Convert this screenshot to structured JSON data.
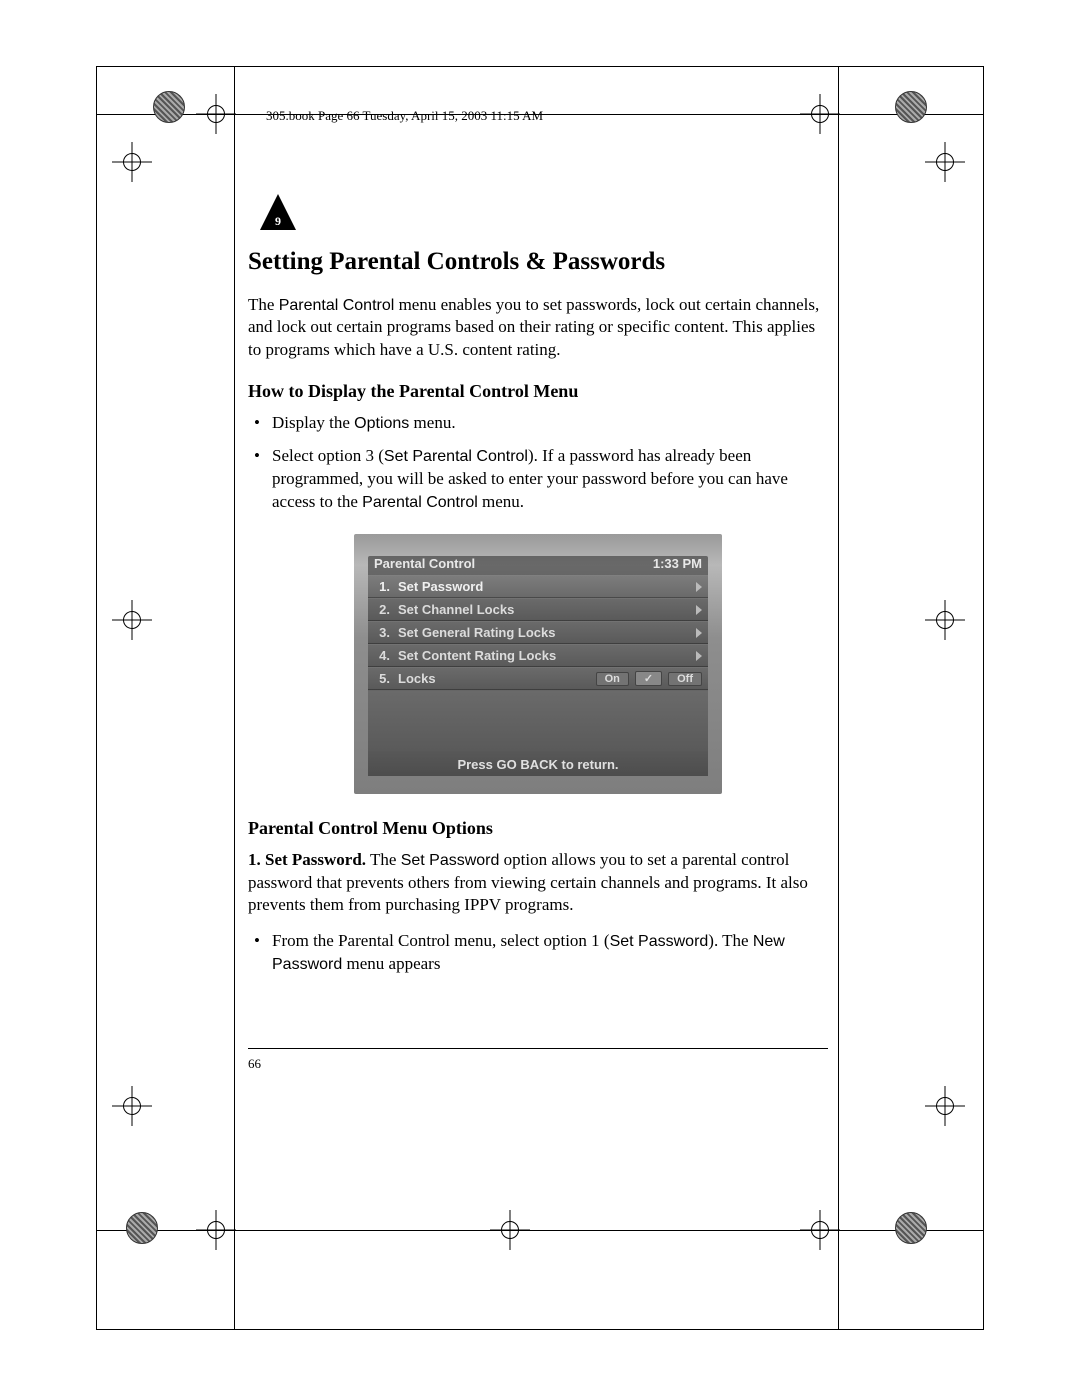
{
  "meta": {
    "header_line": "305.book  Page 66  Tuesday, April 15, 2003  11:15 AM",
    "page_number": "66",
    "chapter_tab": "9"
  },
  "headings": {
    "h1": "Setting Parental Controls & Passwords",
    "h2a": "How to Display the Parental Control Menu",
    "h2b": "Parental Control Menu Options"
  },
  "intro": {
    "pre": " The ",
    "term": "Parental Control",
    "post": " menu enables you to set passwords, lock out certain channels, and lock out certain programs based on their rating or specific content. This applies to programs which have a U.S. content rating."
  },
  "howto_bullets": [
    {
      "pre": "Display the ",
      "term": "Options",
      "post": " menu."
    },
    {
      "pre": "Select option 3 (",
      "term": "Set Parental Control",
      "mid": "). If a password has already been programmed, you will be asked to enter your password before you can have access to the ",
      "term2": "Parental Control",
      "post": " menu."
    }
  ],
  "osd": {
    "title": "Parental Control",
    "clock": "1:33 PM",
    "rows": [
      {
        "n": "1.",
        "label": "Set Password",
        "hl": true
      },
      {
        "n": "2.",
        "label": "Set Channel Locks"
      },
      {
        "n": "3.",
        "label": "Set General Rating Locks"
      },
      {
        "n": "4.",
        "label": "Set Content Rating Locks"
      },
      {
        "n": "5.",
        "label": "Locks",
        "onoff": true
      }
    ],
    "on": "On",
    "off": "Off",
    "footer": "Press GO BACK to return."
  },
  "options_para": {
    "lead_bold": "1. Set Password.",
    "pre": " The ",
    "term": "Set Password",
    "post": " option allows you to set a parental control password that prevents others from viewing certain channels and programs. It also prevents them from purchasing IPPV programs."
  },
  "options_bullet": {
    "pre": "From the Parental Control menu, select option 1 (",
    "term": "Set Password",
    "mid": "). The ",
    "term2": "New Password",
    "post": " menu appears"
  }
}
